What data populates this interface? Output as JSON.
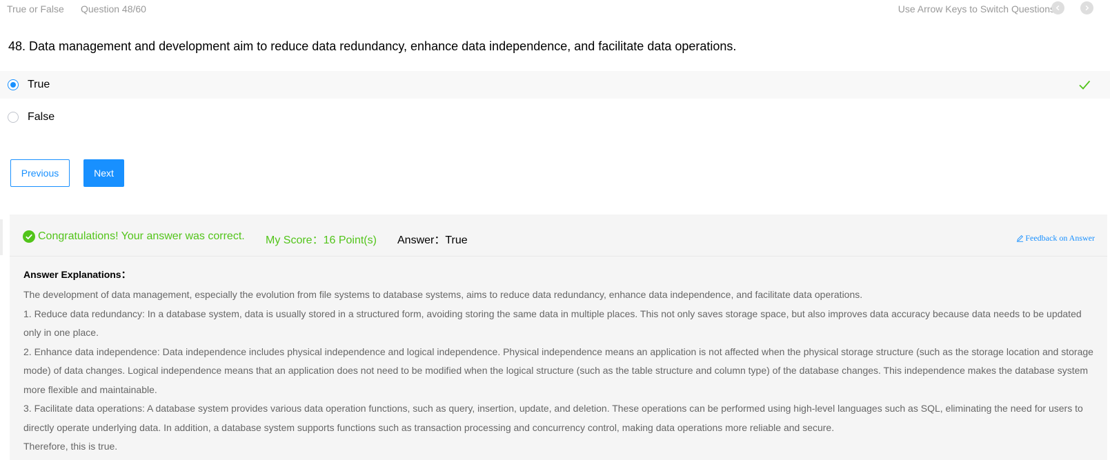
{
  "topbar": {
    "question_type": "True or False",
    "question_number": "Question 48/60",
    "hint": "Use Arrow Keys to Switch Questions",
    "prev_icon": "chevron-left-icon",
    "next_icon": "chevron-right-icon"
  },
  "question": {
    "text": "48. Data management and development aim to reduce data redundancy, enhance data independence, and facilitate data operations."
  },
  "options": [
    {
      "label": "True",
      "selected": true,
      "correct": true
    },
    {
      "label": "False",
      "selected": false,
      "correct": false
    }
  ],
  "buttons": {
    "previous": "Previous",
    "next": "Next"
  },
  "result": {
    "message": "Congratulations! Your answer was correct.",
    "score": "My Score：16 Point(s)",
    "answer": "Answer：True",
    "feedback_link": "Feedback on Answer"
  },
  "explanation": {
    "title": "Answer Explanations：",
    "paragraphs": [
      "The development of data management, especially the evolution from file systems to database systems, aims to reduce data redundancy, enhance data independence, and facilitate data operations.",
      "1. Reduce data redundancy: In a database system, data is usually stored in a structured form, avoiding storing the same data in multiple places. This not only saves storage space, but also improves data accuracy because data needs to be updated only in one place.",
      "2. Enhance data independence: Data independence includes physical independence and logical independence. Physical independence means an application is not affected when the physical storage structure (such as the storage location and storage mode) of data changes. Logical independence means that an application does not need to be modified when the logical structure (such as the table structure and column type) of the database changes. This independence makes the database system more flexible and maintainable.",
      "3. Facilitate data operations: A database system provides various data operation functions, such as query, insertion, update, and deletion. These operations can be performed using high-level languages such as SQL, eliminating the need for users to directly operate underlying data. In addition, a database system supports functions such as transaction processing and concurrency control, making data operations more reliable and secure.",
      "Therefore, this is true."
    ]
  },
  "colors": {
    "accent": "#1890ff",
    "success": "#52c41a",
    "muted_text": "#999999",
    "body_text": "#666666"
  }
}
